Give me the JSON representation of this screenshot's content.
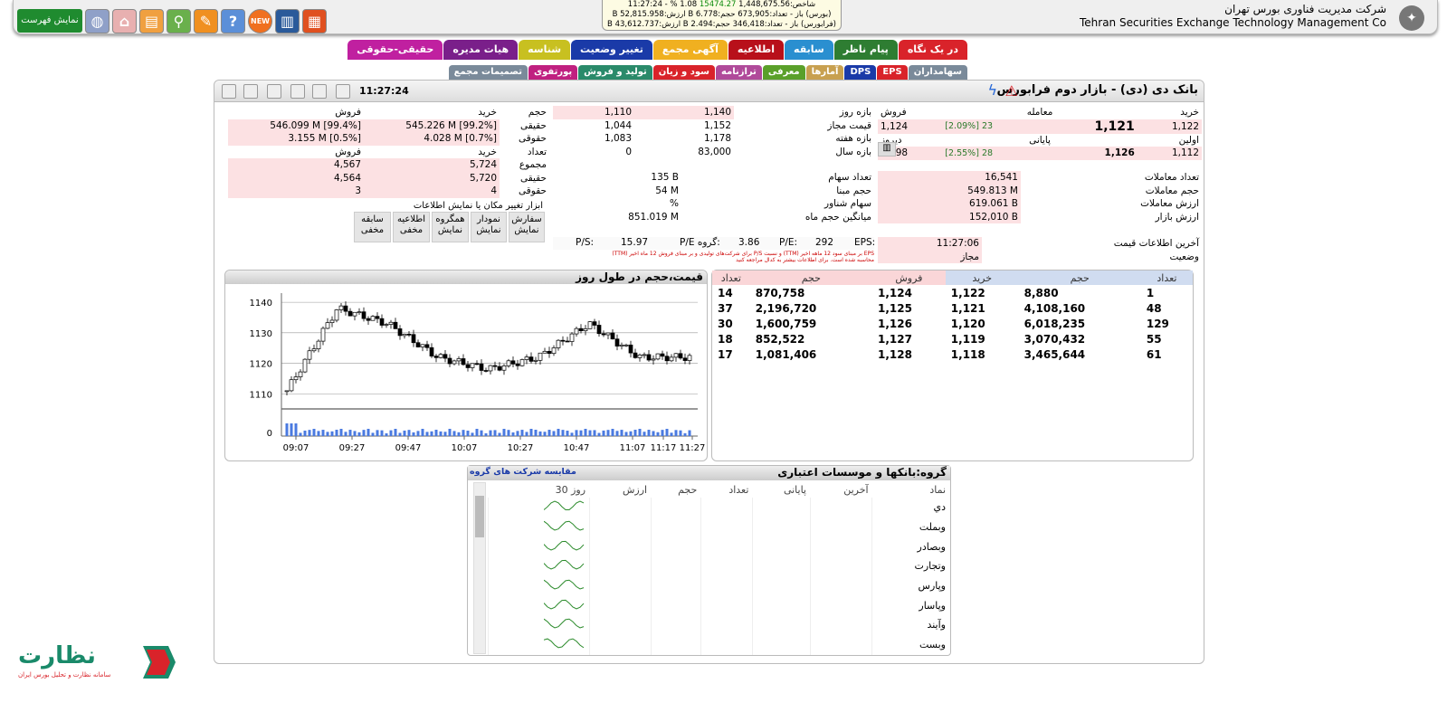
{
  "topbar": {
    "show_list": "نمایش فهرست",
    "brand_fa": "شرکت مدیریت فناوری بورس تهران",
    "brand_en": "Tehran Securities Exchange Technology Management Co",
    "ticker": {
      "line1_a": "شاخص:1,448,675.56",
      "line1_b": "15474.27",
      "line1_c": "1.08 %",
      "line1_d": "- 11:27:24",
      "line2": "(بورس) باز - تعداد:673,905 حجم:6.778 B ارزش:52,815.958 B",
      "line3": "(فرابورس) باز - تعداد:346,418 حجم:2.494 B ارزش:43,612.737 B"
    },
    "icons": [
      "grid-icon",
      "news-badge-icon",
      "help-icon",
      "chat-icon",
      "search-icon",
      "table-icon",
      "home-icon",
      "globe-icon"
    ],
    "new_badge": "NEW"
  },
  "tabs_row1": [
    "در یک نگاه",
    "پیام ناظر",
    "سابقه",
    "اطلاعیه",
    "آگهی مجمع",
    "تغییر وضعیت",
    "شناسه",
    "هیات مدیره",
    "حقیقی-حقوقی"
  ],
  "tabs_row2": [
    "سهامداران",
    "EPS",
    "DPS",
    "آمارها",
    "معرفی",
    "ترازنامه",
    "سود و زیان",
    "تولید و فروش",
    "پورتفوی",
    "تصمیمات مجمع"
  ],
  "header": {
    "title": "بانک دی (دی) - بازار دوم فرابورس",
    "time": "11:27:24"
  },
  "price_block": {
    "col_buy": "خرید",
    "col_trade": "معامله",
    "col_sell": "فروش",
    "row1_buy": "1,122",
    "row1_trade": "1,121",
    "row1_count": "23",
    "row1_pct": "[2.09%]",
    "row1_sell": "1,124",
    "row2_label": "اولین",
    "row2_sub": "پایانی",
    "row2_prev": "دیروز",
    "row3_first": "1,112",
    "row3_final": "1,126",
    "row3_count": "28",
    "row3_pct": "[2.55%]",
    "row3_prev": "1,098",
    "range_day": "بازه روز",
    "allowed_price": "قیمت مجاز",
    "range_week": "بازه هفته",
    "range_year": "بازه سال",
    "day_lo": "1,110",
    "day_hi": "1,140",
    "allowed_lo": "1,044",
    "allowed_hi": "1,152",
    "week_lo": "1,083",
    "week_hi": "1,178",
    "year_lo": "0",
    "year_hi": "83,000"
  },
  "stats": {
    "trades_count_label": "تعداد معاملات",
    "trades_count": "16,541",
    "volume_label": "حجم معاملات",
    "volume": "549.813 M",
    "value_label": "ارزش معاملات",
    "value": "619.061 B",
    "mcap_label": "ارزش بازار",
    "mcap": "152,010 B",
    "shares_label": "تعداد سهام",
    "shares": "135 B",
    "base_vol_label": "حجم مبنا",
    "base_vol": "54 M",
    "float_label": "سهام شناور",
    "float": "%",
    "avg_vol_label": "میانگین حجم ماه",
    "avg_vol": "851.019 M",
    "last_update_label": "آخرین اطلاعات قیمت",
    "last_update": "11:27:06",
    "status_label": "وضعیت",
    "status": "مجاز",
    "eps_label": "EPS:",
    "eps": "",
    "pe_label": "P/E:",
    "pe": "292",
    "gpe_label": "P/E گروه:",
    "gpe": "3.86",
    "ps_label": "P/S:",
    "ps": "15.97",
    "note1": "EPS بر مبنای سود 12 ماهه اخیر (TTM) و نسبت P/S برای شرکت‌های تولیدی و بر مبنای فروش 12 ماه اخیر (TTM)",
    "note2": "محاسبه شده است. برای اطلاعات بیشتر به کدال مراجعه کنید"
  },
  "legal": {
    "buy": "خرید",
    "sell": "فروش",
    "vol": "حجم",
    "real": "حقیقی",
    "legal": "حقوقی",
    "count": "تعداد",
    "total": "مجموع",
    "real_buy": "545.226 M [99.2%]",
    "real_sell": "546.099 M [99.4%]",
    "legal_buy": "4.028 M [0.7%]",
    "legal_sell": "3.155 M [0.5%]",
    "total_buy": "5,724",
    "total_sell": "4,567",
    "real_cnt_buy": "5,720",
    "real_cnt_sell": "4,564",
    "legal_cnt_buy": "4",
    "legal_cnt_sell": "3"
  },
  "tools": {
    "label": "ابزار تغییر مکان یا نمایش اطلاعات",
    "items": [
      "سفارش نمایش",
      "نمودار نمایش",
      "همگروه نمایش",
      "اطلاعیه مخفی",
      "سابقه مخفی"
    ]
  },
  "chart": {
    "title": "قیمت،حجم در طول روز",
    "y_ticks": [
      "1140",
      "1130",
      "1120",
      "1110"
    ],
    "vol_tick": "0",
    "x_ticks": [
      "09:07",
      "09:27",
      "09:47",
      "10:07",
      "10:27",
      "10:47",
      "11:07",
      "11:17",
      "11:27"
    ]
  },
  "chart_data": {
    "type": "candlestick",
    "title": "قیمت،حجم در طول روز",
    "ylim": [
      1108,
      1143
    ],
    "x": [
      "09:07",
      "09:27",
      "09:47",
      "10:07",
      "10:27",
      "10:47",
      "11:07",
      "11:17",
      "11:27"
    ],
    "close_trend": [
      1111,
      1138,
      1133,
      1122,
      1118,
      1122,
      1133,
      1122,
      1122
    ]
  },
  "depth": {
    "headers": [
      "تعداد",
      "حجم",
      "خرید",
      "فروش",
      "حجم",
      "تعداد"
    ],
    "rows": [
      [
        "1",
        "8,880",
        "1,122",
        "1,124",
        "870,758",
        "14"
      ],
      [
        "48",
        "4,108,160",
        "1,121",
        "1,125",
        "2,196,720",
        "37"
      ],
      [
        "129",
        "6,018,235",
        "1,120",
        "1,126",
        "1,600,759",
        "30"
      ],
      [
        "55",
        "3,070,432",
        "1,119",
        "1,127",
        "852,522",
        "18"
      ],
      [
        "61",
        "3,465,644",
        "1,118",
        "1,128",
        "1,081,406",
        "17"
      ]
    ]
  },
  "group": {
    "title": "گروه:بانکها و موسسات اعتباری",
    "compare": "مقایسه شرکت های گروه",
    "headers": [
      "نماد",
      "آخرین",
      "پایانی",
      "تعداد",
      "حجم",
      "ارزش",
      "30 روز"
    ],
    "symbols": [
      "دي",
      "وبملت",
      "وبصادر",
      "وتجارت",
      "وپارس",
      "وپاسار",
      "وآیند",
      "وبست"
    ]
  },
  "footer": {
    "logo_text": "نظارت",
    "logo_sub": "سامانه نظارت و تحلیل بورس ایران"
  }
}
